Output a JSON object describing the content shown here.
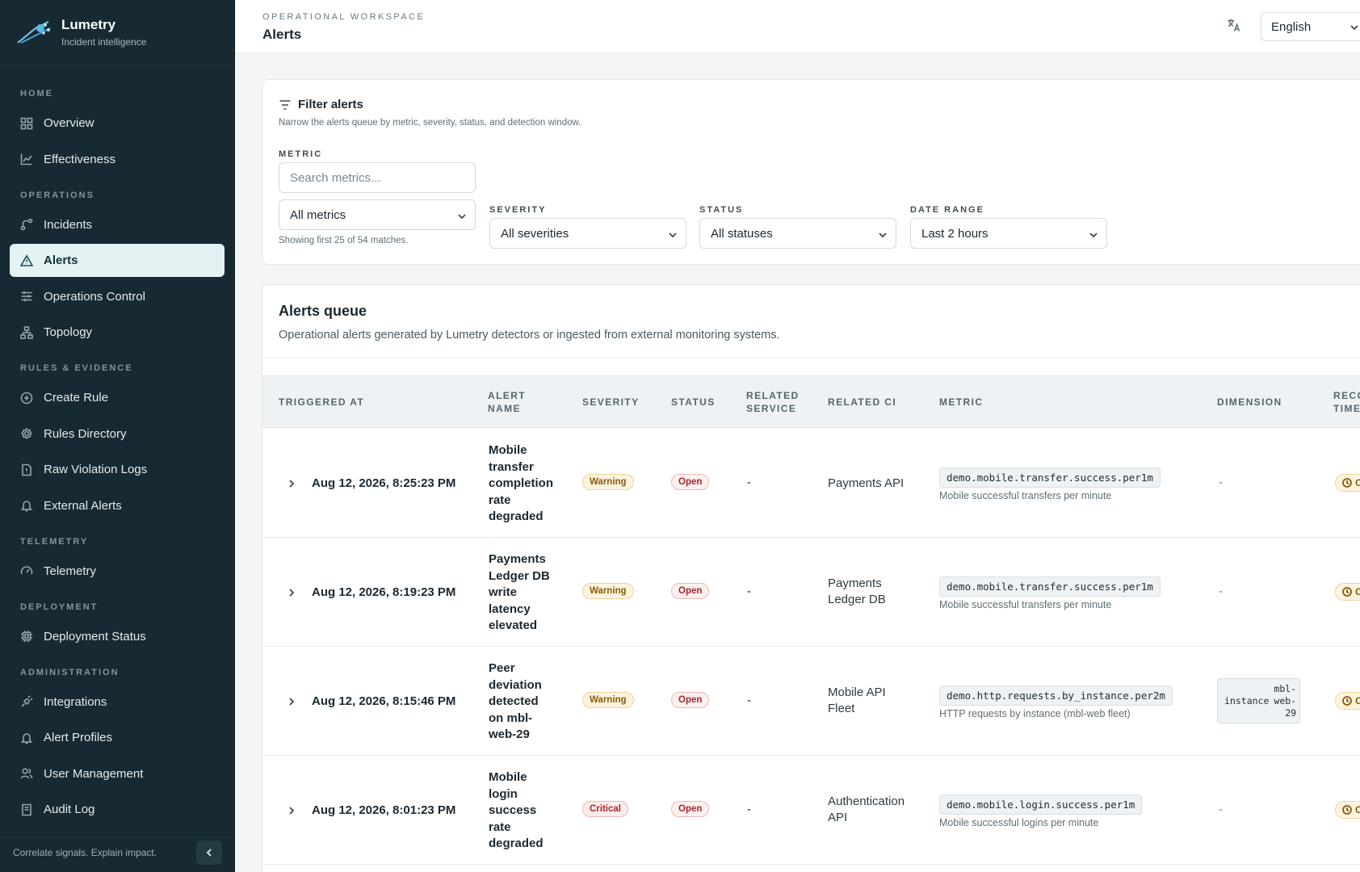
{
  "brand": {
    "name": "Lumetry",
    "tagline": "Incident intelligence"
  },
  "sidebar": {
    "sections": [
      {
        "label": "HOME",
        "items": [
          {
            "label": "Overview",
            "icon": "grid-icon"
          },
          {
            "label": "Effectiveness",
            "icon": "line-chart-icon"
          }
        ]
      },
      {
        "label": "OPERATIONS",
        "items": [
          {
            "label": "Incidents",
            "icon": "route-icon"
          },
          {
            "label": "Alerts",
            "icon": "warning-triangle-icon",
            "active": true
          },
          {
            "label": "Operations Control",
            "icon": "sliders-icon"
          },
          {
            "label": "Topology",
            "icon": "topology-icon"
          }
        ]
      },
      {
        "label": "RULES & EVIDENCE",
        "items": [
          {
            "label": "Create Rule",
            "icon": "plus-circle-icon"
          },
          {
            "label": "Rules Directory",
            "icon": "gear-icon"
          },
          {
            "label": "Raw Violation Logs",
            "icon": "document-alert-icon"
          },
          {
            "label": "External Alerts",
            "icon": "bell-icon"
          }
        ]
      },
      {
        "label": "TELEMETRY",
        "items": [
          {
            "label": "Telemetry",
            "icon": "gauge-icon"
          }
        ]
      },
      {
        "label": "DEPLOYMENT",
        "items": [
          {
            "label": "Deployment Status",
            "icon": "chip-icon"
          }
        ]
      },
      {
        "label": "ADMINISTRATION",
        "items": [
          {
            "label": "Integrations",
            "icon": "plug-icon"
          },
          {
            "label": "Alert Profiles",
            "icon": "bell-icon"
          },
          {
            "label": "User Management",
            "icon": "users-icon"
          },
          {
            "label": "Audit Log",
            "icon": "audit-icon"
          }
        ]
      }
    ],
    "footer_text": "Correlate signals. Explain impact."
  },
  "header": {
    "eyebrow": "OPERATIONAL WORKSPACE",
    "title": "Alerts",
    "language": "English"
  },
  "filters": {
    "title": "Filter alerts",
    "description": "Narrow the alerts queue by metric, severity, status, and detection window.",
    "metric_label": "METRIC",
    "metric_search_placeholder": "Search metrics...",
    "metric_select": "All metrics",
    "metric_hint": "Showing first 25 of 54 matches.",
    "severity_label": "SEVERITY",
    "severity_select": "All severities",
    "status_label": "STATUS",
    "status_select": "All statuses",
    "date_label": "DATE RANGE",
    "date_select": "Last 2 hours"
  },
  "queue": {
    "title": "Alerts queue",
    "description": "Operational alerts generated by Lumetry detectors or ingested from external monitoring systems.",
    "columns": {
      "triggered": "TRIGGERED AT",
      "alert_name_1": "ALERT",
      "alert_name_2": "NAME",
      "severity": "SEVERITY",
      "status": "STATUS",
      "service_1": "RELATED",
      "service_2": "SERVICE",
      "ci": "RELATED CI",
      "metric": "METRIC",
      "dimension": "DIMENSION",
      "rec_1": "RECO",
      "rec_2": "TIME"
    },
    "rows": [
      {
        "triggered": "Aug 12, 2026, 8:25:23 PM",
        "name_lines": [
          "Mobile",
          "transfer",
          "completion",
          "rate",
          "degraded"
        ],
        "severity": "Warning",
        "status": "Open",
        "service": "-",
        "ci_lines": [
          "Payments API"
        ],
        "metric": "demo.mobile.transfer.success.per1m",
        "metric_desc": "Mobile successful transfers per minute",
        "dimension": "-",
        "rec": "O"
      },
      {
        "triggered": "Aug 12, 2026, 8:19:23 PM",
        "name_lines": [
          "Payments",
          "Ledger DB",
          "write",
          "latency",
          "elevated"
        ],
        "severity": "Warning",
        "status": "Open",
        "service": "-",
        "ci_lines": [
          "Payments",
          "Ledger DB"
        ],
        "metric": "demo.mobile.transfer.success.per1m",
        "metric_desc": "Mobile successful transfers per minute",
        "dimension": "-",
        "rec": "O"
      },
      {
        "triggered": "Aug 12, 2026, 8:15:46 PM",
        "name_lines": [
          "Peer",
          "deviation",
          "detected",
          "on mbl-",
          "web-29"
        ],
        "severity": "Warning",
        "status": "Open",
        "service": "-",
        "ci_lines": [
          "Mobile API",
          "Fleet"
        ],
        "metric": "demo.http.requests.by_instance.per2m",
        "metric_desc": "HTTP requests by instance (mbl-web fleet)",
        "dimension_key": "instance",
        "dimension_val_lines": [
          "mbl-",
          "web-",
          "29"
        ],
        "rec": "O"
      },
      {
        "triggered": "Aug 12, 2026, 8:01:23 PM",
        "name_lines": [
          "Mobile",
          "login",
          "success",
          "rate",
          "degraded"
        ],
        "severity": "Critical",
        "status": "Open",
        "service": "-",
        "ci_lines": [
          "Authentication",
          "API"
        ],
        "metric": "demo.mobile.login.success.per1m",
        "metric_desc": "Mobile successful logins per minute",
        "dimension": "-",
        "rec": "O"
      }
    ]
  }
}
